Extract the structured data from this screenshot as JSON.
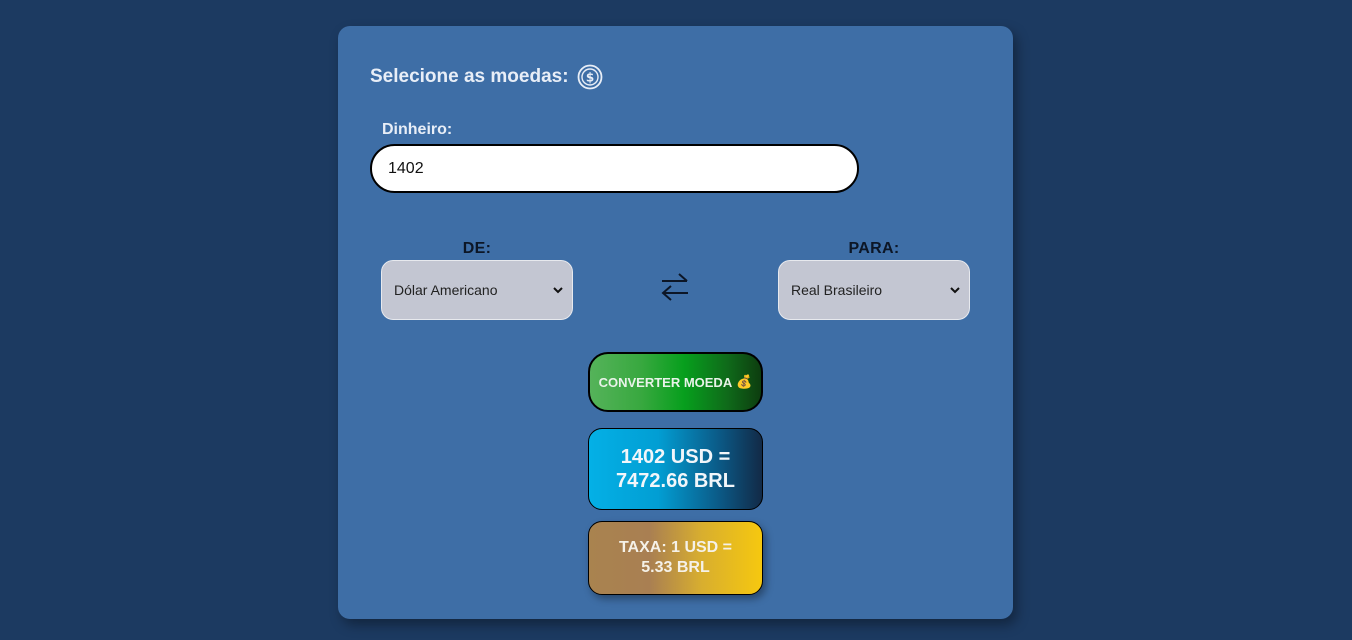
{
  "header": {
    "title": "Selecione as moedas:",
    "icon": "dollar-coin-icon"
  },
  "amount": {
    "label": "Dinheiro:",
    "value": "1402"
  },
  "from": {
    "label": "DE:",
    "selected": "Dólar Americano"
  },
  "to": {
    "label": "PARA:",
    "selected": "Real Brasileiro"
  },
  "swap": {
    "icon": "swap-arrows-icon"
  },
  "convert": {
    "label": "CONVERTER MOEDA",
    "emoji": "💰"
  },
  "result": {
    "line1": "1402 USD =",
    "line2": "7472.66 BRL"
  },
  "rate": {
    "line1": "TAXA: 1 USD =",
    "line2": "5.33 BRL"
  },
  "colors": {
    "background": "#1c3a61",
    "card": "#3e6ea6",
    "convert_accent": "#079f1d",
    "result_accent": "#04b0e6",
    "rate_accent": "#f6c80f"
  }
}
